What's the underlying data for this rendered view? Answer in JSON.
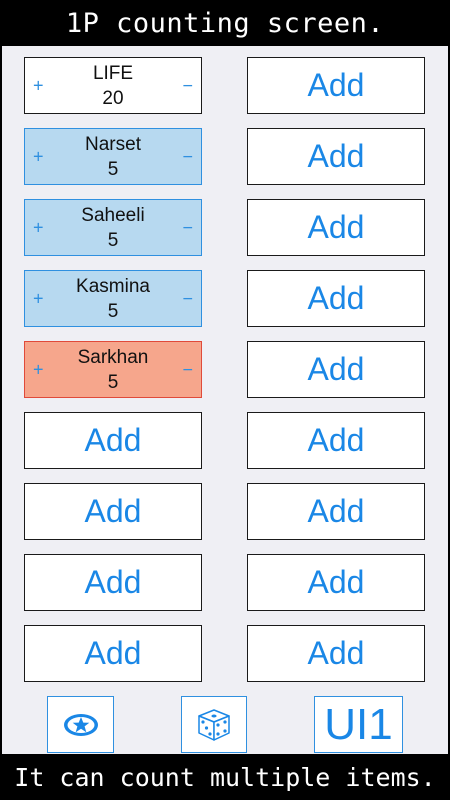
{
  "header": {
    "title": "1P counting screen."
  },
  "footer": {
    "caption": "It can count multiple items."
  },
  "counters": [
    {
      "name": "LIFE",
      "value": "20",
      "color": "#ffffff"
    },
    {
      "name": "Narset",
      "value": "5",
      "color": "#b7d9f0"
    },
    {
      "name": "Saheeli",
      "value": "5",
      "color": "#b7d9f0"
    },
    {
      "name": "Kasmina",
      "value": "5",
      "color": "#b7d9f0"
    },
    {
      "name": "Sarkhan",
      "value": "5",
      "color": "#f6a68c"
    }
  ],
  "counter_controls": {
    "plus": "+",
    "minus": "−"
  },
  "add_label": "Add",
  "toolbar": {
    "star_icon": "star-icon",
    "dice_icon": "dice-icon",
    "ui_label": "UI1"
  },
  "colors": {
    "accent": "#1a87e6",
    "blue_border": "#2f90e0",
    "red_border": "#e04a3a"
  }
}
